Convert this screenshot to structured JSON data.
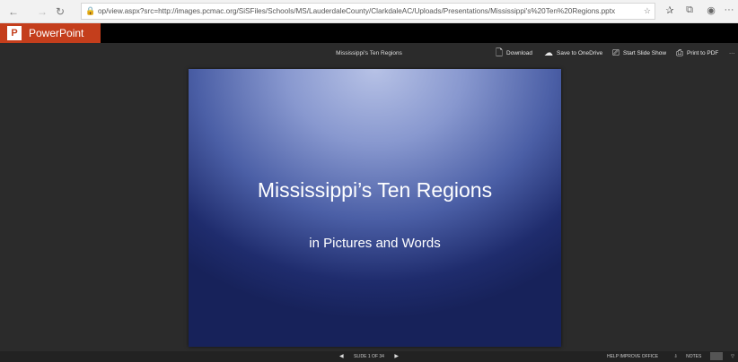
{
  "browser": {
    "back_icon": "←",
    "forward_icon": "→",
    "refresh_icon": "↻",
    "lock_icon": "🔒",
    "url": "op/view.aspx?src=http://images.pcmac.org/SiSFiles/Schools/MS/LauderdaleCounty/ClarkdaleAC/Uploads/Presentations/Mississippi's%20Ten%20Regions.pptx",
    "favorite_icon": "☆",
    "favorites_icon": "✰",
    "collections_icon": "⧉",
    "profile_icon": "◉",
    "more_icon": "···"
  },
  "app": {
    "logo": "P",
    "name": "PowerPoint",
    "brand_color": "#c43e1c"
  },
  "toolbar": {
    "doc_title": "Mississippi's Ten Regions",
    "download": "Download",
    "save_onedrive": "Save to OneDrive",
    "start_slideshow": "Start Slide Show",
    "print_pdf": "Print to PDF",
    "more": "···"
  },
  "slide": {
    "title": "Mississippi’s Ten Regions",
    "subtitle": "in Pictures and Words"
  },
  "status": {
    "prev_icon": "◀",
    "slide_counter": "SLIDE 1 OF 34",
    "next_icon": "▶",
    "help_improve": "HELP IMPROVE OFFICE",
    "notes": "NOTES"
  }
}
